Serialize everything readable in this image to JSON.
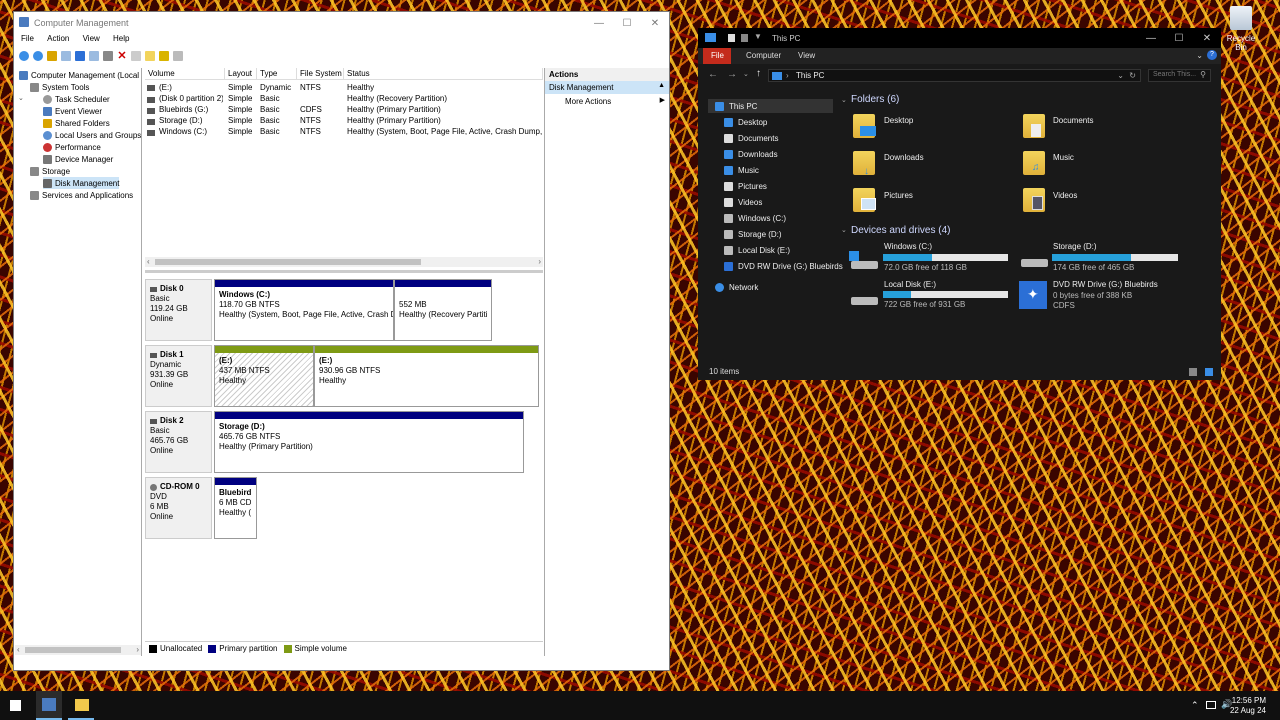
{
  "cm": {
    "title": "Computer Management",
    "menu": [
      "File",
      "Action",
      "View",
      "Help"
    ],
    "tree": [
      {
        "label": "Computer Management (Local",
        "indent": 0,
        "icon": "computer-icon",
        "color": "#4a7bbf"
      },
      {
        "label": "System Tools",
        "indent": 1,
        "icon": "tools-icon",
        "color": "#888"
      },
      {
        "label": "Task Scheduler",
        "indent": 2,
        "icon": "clock-icon",
        "color": "#999"
      },
      {
        "label": "Event Viewer",
        "indent": 2,
        "icon": "event-viewer-icon",
        "color": "#4a7bbf"
      },
      {
        "label": "Shared Folders",
        "indent": 2,
        "icon": "shared-folder-icon",
        "color": "#d9a400"
      },
      {
        "label": "Local Users and Groups",
        "indent": 2,
        "icon": "users-icon",
        "color": "#5b8fd1"
      },
      {
        "label": "Performance",
        "indent": 2,
        "icon": "performance-icon",
        "color": "#cc3333"
      },
      {
        "label": "Device Manager",
        "indent": 2,
        "icon": "device-manager-icon",
        "color": "#777"
      },
      {
        "label": "Storage",
        "indent": 1,
        "icon": "storage-icon",
        "color": "#888"
      },
      {
        "label": "Disk Management",
        "indent": 2,
        "icon": "disk-icon",
        "color": "#666"
      },
      {
        "label": "Services and Applications",
        "indent": 1,
        "icon": "services-icon",
        "color": "#888"
      }
    ],
    "columns": [
      "Volume",
      "Layout",
      "Type",
      "File System",
      "Status"
    ],
    "volumes": [
      [
        "(E:)",
        "Simple",
        "Dynamic",
        "NTFS",
        "Healthy"
      ],
      [
        "(Disk 0 partition 2)",
        "Simple",
        "Basic",
        "",
        "Healthy (Recovery Partition)"
      ],
      [
        "Bluebirds (G:)",
        "Simple",
        "Basic",
        "CDFS",
        "Healthy (Primary Partition)"
      ],
      [
        "Storage (D:)",
        "Simple",
        "Basic",
        "NTFS",
        "Healthy (Primary Partition)"
      ],
      [
        "Windows (C:)",
        "Simple",
        "Basic",
        "NTFS",
        "Healthy (System, Boot, Page File, Active, Crash Dump, I"
      ]
    ],
    "disks": [
      {
        "name": "Disk 0",
        "type": "Basic",
        "size": "119.24 GB",
        "state": "Online",
        "parts": [
          {
            "title": "Windows  (C:)",
            "line2": "118.70 GB NTFS",
            "line3": "Healthy (System, Boot, Page File, Active, Crash D",
            "color": "#000080"
          },
          {
            "title": "",
            "line2": "552 MB",
            "line3": "Healthy (Recovery Partiti",
            "color": "#000080"
          }
        ]
      },
      {
        "name": "Disk 1",
        "type": "Dynamic",
        "size": "931.39 GB",
        "state": "Online",
        "parts": [
          {
            "title": "(E:)",
            "line2": "437 MB NTFS",
            "line3": "Healthy",
            "color": "#7e9a14"
          },
          {
            "title": "(E:)",
            "line2": "930.96 GB NTFS",
            "line3": "Healthy",
            "color": "#7e9a14"
          }
        ]
      },
      {
        "name": "Disk 2",
        "type": "Basic",
        "size": "465.76 GB",
        "state": "Online",
        "parts": [
          {
            "title": "Storage  (D:)",
            "line2": "465.76 GB NTFS",
            "line3": "Healthy (Primary Partition)",
            "color": "#000080"
          }
        ]
      },
      {
        "name": "CD-ROM 0",
        "type": "DVD",
        "size": "6 MB",
        "state": "Online",
        "parts": [
          {
            "title": "Bluebird",
            "line2": "6 MB CD",
            "line3": "Healthy (",
            "color": "#000080"
          }
        ]
      }
    ],
    "legend": [
      {
        "label": "Unallocated",
        "color": "#000000"
      },
      {
        "label": "Primary partition",
        "color": "#000080"
      },
      {
        "label": "Simple volume",
        "color": "#7e9a14"
      }
    ],
    "actions": {
      "header": "Actions",
      "section": "Disk Management",
      "more": "More Actions"
    }
  },
  "explorer": {
    "title": "This PC",
    "ribbon_tabs": [
      "File",
      "Computer",
      "View"
    ],
    "address": "This PC",
    "search_placeholder": "Search This...",
    "nav": [
      {
        "label": "This PC",
        "icon": "this-pc-icon",
        "color": "#3a8ee6",
        "indent": 0
      },
      {
        "label": "Desktop",
        "icon": "desktop-icon",
        "color": "#3a8ee6",
        "indent": 1
      },
      {
        "label": "Documents",
        "icon": "documents-icon",
        "color": "#ddd",
        "indent": 1
      },
      {
        "label": "Downloads",
        "icon": "downloads-icon",
        "color": "#3a8ee6",
        "indent": 1
      },
      {
        "label": "Music",
        "icon": "music-icon",
        "color": "#3a8ee6",
        "indent": 1
      },
      {
        "label": "Pictures",
        "icon": "pictures-icon",
        "color": "#ddd",
        "indent": 1
      },
      {
        "label": "Videos",
        "icon": "videos-icon",
        "color": "#ddd",
        "indent": 1
      },
      {
        "label": "Windows (C:)",
        "icon": "drive-icon",
        "color": "#bbb",
        "indent": 1
      },
      {
        "label": "Storage (D:)",
        "icon": "drive-icon",
        "color": "#bbb",
        "indent": 1
      },
      {
        "label": "Local Disk (E:)",
        "icon": "drive-icon",
        "color": "#bbb",
        "indent": 1
      },
      {
        "label": "DVD RW Drive (G:) Bluebirds",
        "icon": "dvd-icon",
        "color": "#2b6fd6",
        "indent": 1
      },
      {
        "label": "Network",
        "icon": "network-icon",
        "color": "#3a8ee6",
        "indent": 0
      }
    ],
    "folders_header": "Folders (6)",
    "folders": [
      "Desktop",
      "Documents",
      "Downloads",
      "Music",
      "Pictures",
      "Videos"
    ],
    "drives_header": "Devices and drives (4)",
    "drives": [
      {
        "name": "Windows (C:)",
        "free": "72.0 GB free of 118 GB",
        "used_fraction": 0.39
      },
      {
        "name": "Storage (D:)",
        "free": "174 GB free of 465 GB",
        "used_fraction": 0.63
      },
      {
        "name": "Local Disk (E:)",
        "free": "722 GB free of 931 GB",
        "used_fraction": 0.22
      }
    ],
    "dvd": {
      "name": "DVD RW Drive (G:) Bluebirds",
      "line2": "0 bytes free of 388 KB",
      "line3": "CDFS"
    },
    "status": "10 items"
  },
  "desktop": {
    "recycle_bin": "Recycle Bin"
  },
  "taskbar": {
    "time": "12:56 PM",
    "date": "22 Aug 24"
  }
}
